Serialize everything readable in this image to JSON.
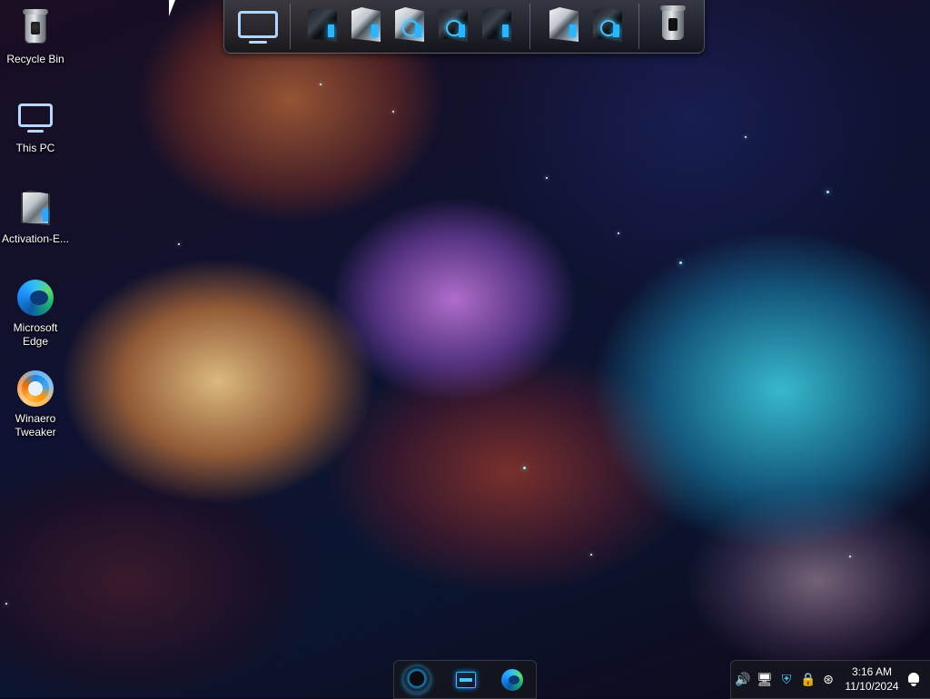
{
  "desktop": {
    "icons": [
      {
        "label": "Recycle Bin",
        "icon": "recycle-bin-icon"
      },
      {
        "label": "This PC",
        "icon": "monitor-icon"
      },
      {
        "label": "Activation-E...",
        "icon": "app-icon"
      },
      {
        "label": "Microsoft\nEdge",
        "icon": "edge-icon"
      },
      {
        "label": "Winaero\nTweaker",
        "icon": "winaero-icon"
      }
    ]
  },
  "dock": {
    "items": [
      {
        "name": "this-pc",
        "icon": "monitor-icon"
      },
      {
        "name": "app-1",
        "icon": "themed-app-icon"
      },
      {
        "name": "app-2",
        "icon": "themed-app-icon"
      },
      {
        "name": "app-3",
        "icon": "themed-app-icon"
      },
      {
        "name": "app-4",
        "icon": "themed-app-icon"
      },
      {
        "name": "app-5",
        "icon": "themed-app-icon"
      },
      {
        "name": "app-6",
        "icon": "themed-app-icon"
      },
      {
        "name": "app-7",
        "icon": "themed-app-icon"
      },
      {
        "name": "recycle-bin",
        "icon": "recycle-bin-icon"
      }
    ]
  },
  "taskbar": {
    "apps": [
      {
        "name": "start",
        "icon": "start-orb-icon"
      },
      {
        "name": "app",
        "icon": "app-icon"
      },
      {
        "name": "edge",
        "icon": "edge-icon"
      }
    ]
  },
  "tray": {
    "icons": [
      "volume-icon",
      "network-icon",
      "security-icon",
      "lock-icon",
      "bluetooth-icon"
    ],
    "time": "3:16 AM",
    "date": "11/10/2024"
  },
  "colors": {
    "accent_blue": "#29b6ff",
    "taskbar_bg": "#14161e"
  }
}
